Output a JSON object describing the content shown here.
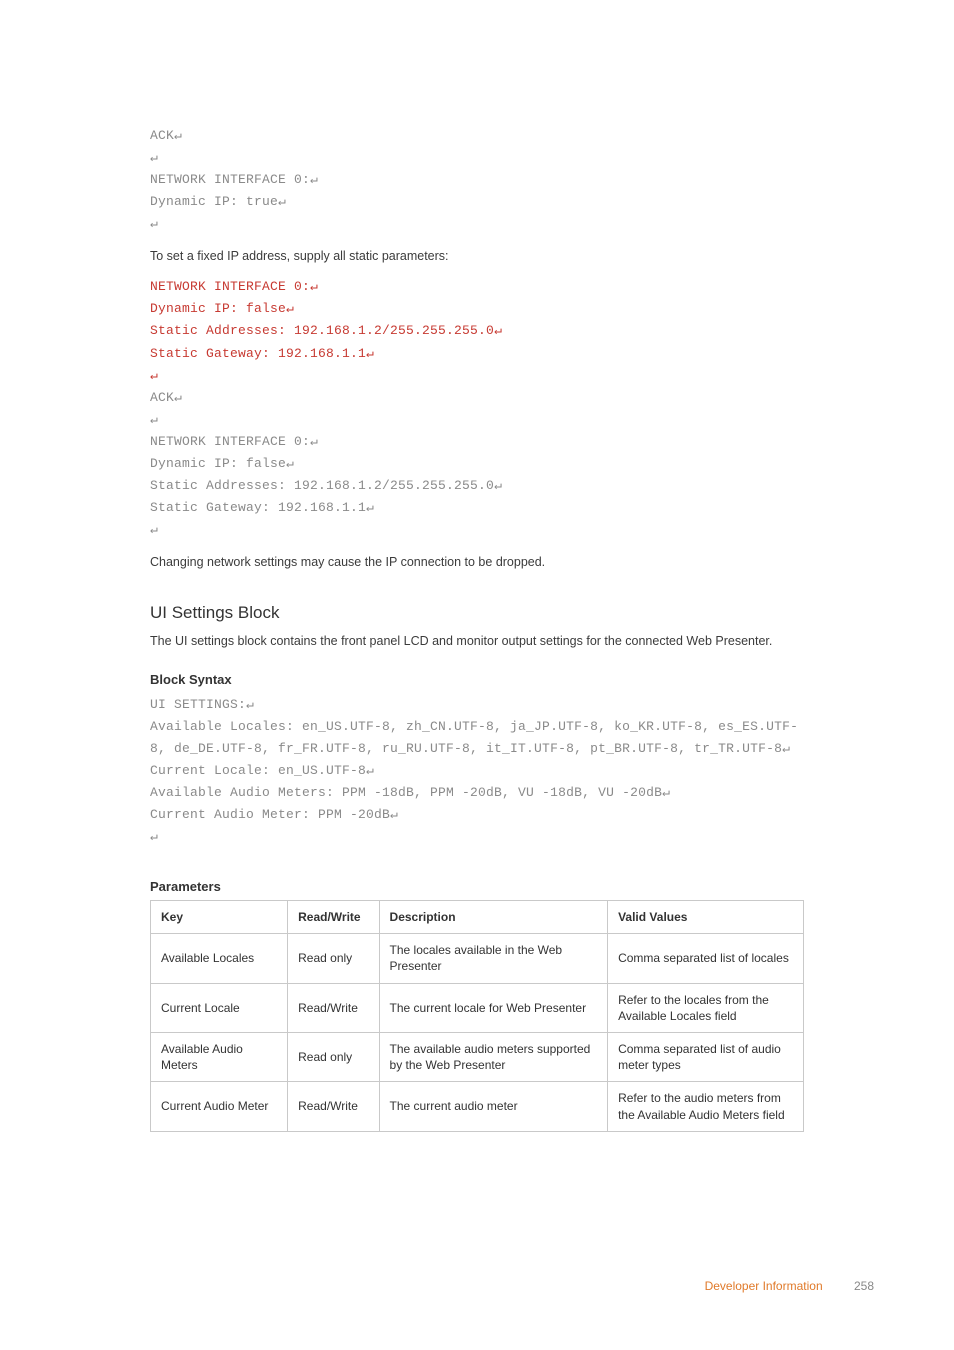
{
  "glyphs": {
    "crlf": "↵"
  },
  "code1": {
    "l1": "ACK",
    "l2": "",
    "l3": "NETWORK INTERFACE 0:",
    "l4": "Dynamic IP: true",
    "l5": ""
  },
  "para1": "To set a fixed IP address, supply all static parameters:",
  "code2_red": {
    "l1": "NETWORK INTERFACE 0:",
    "l2": "Dynamic IP: false",
    "l3": "Static Addresses: 192.168.1.2/255.255.255.0",
    "l4": "Static Gateway: 192.168.1.1",
    "l5": ""
  },
  "code2_grey": {
    "l1": "ACK",
    "l2": "",
    "l3": "NETWORK INTERFACE 0:",
    "l4": "Dynamic IP: false",
    "l5": "Static Addresses: 192.168.1.2/255.255.255.0",
    "l6": "Static Gateway: 192.168.1.1",
    "l7": ""
  },
  "para2": "Changing network settings may cause the IP connection to be dropped.",
  "section_heading": "UI Settings Block",
  "para3": "The UI settings block contains the front panel LCD and monitor output settings for the connected Web Presenter.",
  "block_syntax_label": "Block Syntax",
  "code3": {
    "l1": "UI SETTINGS:",
    "l2": "Available Locales: en_US.UTF-8, zh_CN.UTF-8, ja_JP.UTF-8, ko_KR.UTF-8, es_ES.UTF-8, de_DE.UTF-8, fr_FR.UTF-8, ru_RU.UTF-8, it_IT.UTF-8, pt_BR.UTF-8, tr_TR.UTF-8",
    "l3": "Current Locale: en_US.UTF-8",
    "l4": "Available Audio Meters: PPM -18dB, PPM -20dB, VU -18dB, VU -20dB",
    "l5": "Current Audio Meter: PPM -20dB",
    "l6": ""
  },
  "parameters_label": "Parameters",
  "table": {
    "head": {
      "key": "Key",
      "rw": "Read/Write",
      "desc": "Description",
      "vv": "Valid Values"
    },
    "rows": [
      {
        "key": "Available Locales",
        "rw": "Read only",
        "desc": "The locales available in the Web Presenter",
        "vv": "Comma separated list of locales"
      },
      {
        "key": "Current Locale",
        "rw": "Read/Write",
        "desc": "The current locale for Web Presenter",
        "vv": "Refer to the locales from the Available Locales field"
      },
      {
        "key": "Available Audio Meters",
        "rw": "Read only",
        "desc": "The available audio meters supported by the Web Presenter",
        "vv": "Comma separated list of audio meter types"
      },
      {
        "key": "Current Audio Meter",
        "rw": "Read/Write",
        "desc": "The current audio meter",
        "vv": "Refer to the audio meters from the Available Audio Meters field"
      }
    ]
  },
  "footer": {
    "label": "Developer Information",
    "page": "258"
  }
}
